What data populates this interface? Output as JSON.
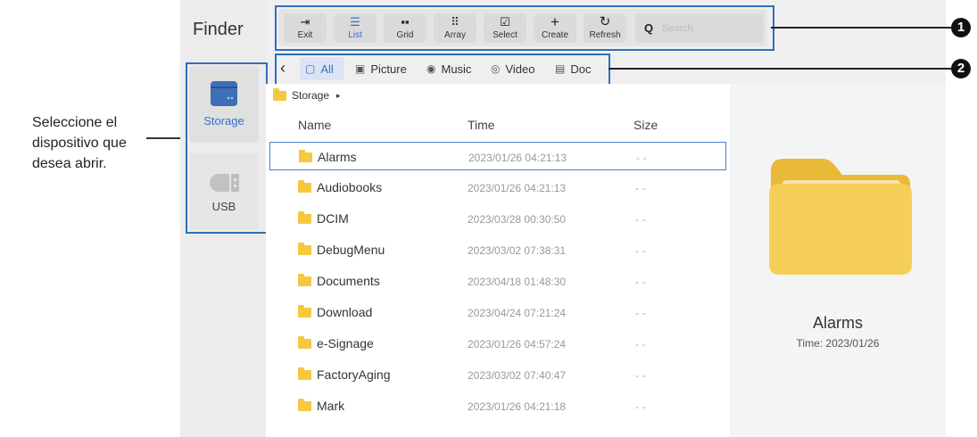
{
  "annotation": {
    "device_hint": "Seleccione el dispositivo que desea abrir."
  },
  "app": {
    "title": "Finder"
  },
  "devices": [
    {
      "label": "Storage",
      "icon": "storage-icon",
      "selected": true
    },
    {
      "label": "USB",
      "icon": "usb-icon",
      "selected": false
    }
  ],
  "toolbar": {
    "buttons": [
      {
        "label": "Exit",
        "icon": "exit-icon",
        "glyph": "⇥"
      },
      {
        "label": "List",
        "icon": "list-icon",
        "glyph": "☰",
        "active": true
      },
      {
        "label": "Grid",
        "icon": "grid-icon",
        "glyph": "▪▪"
      },
      {
        "label": "Array",
        "icon": "array-icon",
        "glyph": "⠿"
      },
      {
        "label": "Select",
        "icon": "select-icon",
        "glyph": "☑"
      },
      {
        "label": "Create",
        "icon": "plus-icon",
        "glyph": "+"
      },
      {
        "label": "Refresh",
        "icon": "refresh-icon",
        "glyph": "↻"
      }
    ],
    "search_placeholder": "Search"
  },
  "filters": [
    {
      "label": "All",
      "icon": "all-icon",
      "glyph": "▢",
      "active": true
    },
    {
      "label": "Picture",
      "icon": "picture-icon",
      "glyph": "▣"
    },
    {
      "label": "Music",
      "icon": "music-icon",
      "glyph": "◉"
    },
    {
      "label": "Video",
      "icon": "video-icon",
      "glyph": "◎"
    },
    {
      "label": "Doc",
      "icon": "doc-icon",
      "glyph": "▤"
    }
  ],
  "breadcrumb": {
    "path": "Storage",
    "sep": "▸"
  },
  "columns": {
    "name": "Name",
    "time": "Time",
    "size": "Size"
  },
  "files": [
    {
      "name": "Alarms",
      "time": "2023/01/26 04:21:13",
      "size": "- -",
      "selected": true
    },
    {
      "name": "Audiobooks",
      "time": "2023/01/26 04:21:13",
      "size": "- -"
    },
    {
      "name": "DCIM",
      "time": "2023/03/28 00:30:50",
      "size": "- -"
    },
    {
      "name": "DebugMenu",
      "time": "2023/03/02 07:38:31",
      "size": "- -"
    },
    {
      "name": "Documents",
      "time": "2023/04/18 01:48:30",
      "size": "- -"
    },
    {
      "name": "Download",
      "time": "2023/04/24 07:21:24",
      "size": "- -"
    },
    {
      "name": "e-Signage",
      "time": "2023/01/26 04:57:24",
      "size": "- -"
    },
    {
      "name": "FactoryAging",
      "time": "2023/03/02 07:40:47",
      "size": "- -"
    },
    {
      "name": "Mark",
      "time": "2023/01/26 04:21:18",
      "size": "- -"
    }
  ],
  "preview": {
    "name": "Alarms",
    "time": "Time: 2023/01/26"
  },
  "markers": [
    "1",
    "2"
  ],
  "colors": {
    "accent": "#3a6fc4",
    "highlight_box": "#2f6fb8",
    "folder": "#f6c840"
  }
}
